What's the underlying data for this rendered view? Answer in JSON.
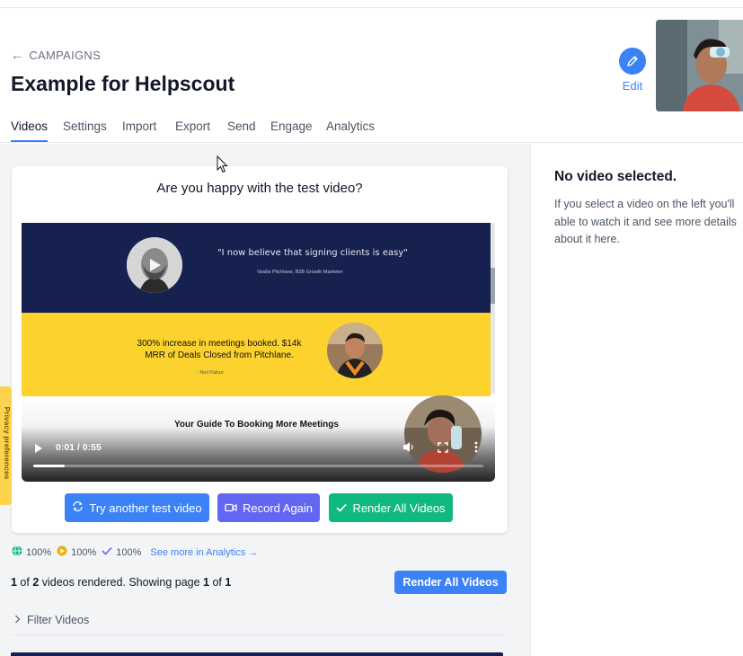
{
  "header": {
    "back_label": "CAMPAIGNS",
    "title": "Example for Helpscout",
    "edit_label": "Edit"
  },
  "tabs": [
    {
      "label": "Videos",
      "active": true
    },
    {
      "label": "Settings"
    },
    {
      "label": "Import"
    },
    {
      "label": "Export"
    },
    {
      "label": "Send"
    },
    {
      "label": "Engage"
    },
    {
      "label": "Analytics"
    }
  ],
  "test_card": {
    "question": "Are you happy with the test video?",
    "video": {
      "quote": "\"I now believe that signing clients is easy\"",
      "attribution": "Vasilis Pitchlane, B2B Growth Marketer",
      "stats_line1": "300% increase in meetings booked. $14k",
      "stats_line2": "MRR of Deals Closed from Pitchlane.",
      "signature": "- Neil Pallan",
      "guide_title": "Your Guide To Booking More Meetings",
      "time": "0:01 / 0:55",
      "progress": 0.07
    },
    "buttons": {
      "try_another": "Try another test video",
      "record_again": "Record Again",
      "render_all": "Render All Videos"
    }
  },
  "stats": {
    "globe_pct": "100%",
    "play_pct": "100%",
    "check_pct": "100%",
    "analytics_link": "See more in Analytics →"
  },
  "render_status": {
    "rendered": "1",
    "of_label": " of ",
    "total": "2",
    "mid_label": " videos rendered. Showing page ",
    "page": "1",
    "of_label2": " of ",
    "pages": "1",
    "button": "Render All Videos"
  },
  "filter": {
    "label": "Filter Videos"
  },
  "right_panel": {
    "title": "No video selected.",
    "body": "If you select a video on the left you'll able to watch it and see more details about it here."
  },
  "privacy_tab": {
    "label": "Privacy preferences"
  },
  "colors": {
    "primary": "#3b82f6",
    "purple": "#6366f1",
    "green": "#10b981",
    "navy": "#162150",
    "yellow": "#fcd22e"
  }
}
